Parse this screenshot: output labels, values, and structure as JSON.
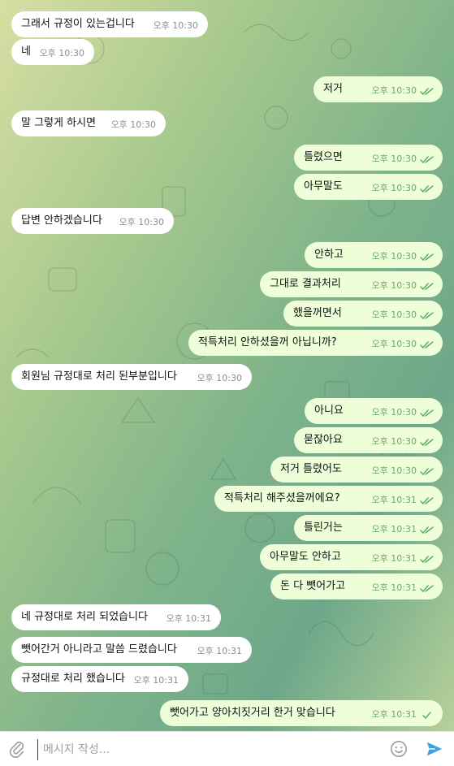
{
  "messages": [
    {
      "dir": "in",
      "text": "그래서 규정이 있는겁니다",
      "time": "오후 10:30"
    },
    {
      "dir": "in",
      "text": "네",
      "time": "오후 10:30"
    },
    {
      "dir": "out",
      "text": "저거",
      "time": "오후 10:30",
      "read": true
    },
    {
      "dir": "in",
      "text": "말 그렇게 하시면",
      "time": "오후 10:30"
    },
    {
      "dir": "out",
      "text": "틀렸으면",
      "time": "오후 10:30",
      "read": true
    },
    {
      "dir": "out",
      "text": "아무말도",
      "time": "오후 10:30",
      "read": true
    },
    {
      "dir": "in",
      "text": "답변 안하겠습니다",
      "time": "오후 10:30"
    },
    {
      "dir": "out",
      "text": "안하고",
      "time": "오후 10:30",
      "read": true
    },
    {
      "dir": "out",
      "text": "그대로 결과처리",
      "time": "오후 10:30",
      "read": true
    },
    {
      "dir": "out",
      "text": "했을꺼면서",
      "time": "오후 10:30",
      "read": true
    },
    {
      "dir": "out",
      "text": "적특처리 안하셨을꺼 아닙니까?",
      "time": "오후 10:30",
      "read": true
    },
    {
      "dir": "in",
      "text": "회원님 규정대로 처리 된부분입니다",
      "time": "오후 10:30"
    },
    {
      "dir": "out",
      "text": "아니요",
      "time": "오후 10:30",
      "read": true
    },
    {
      "dir": "out",
      "text": "묻잖아요",
      "time": "오후 10:30",
      "read": true
    },
    {
      "dir": "out",
      "text": "저거 틀렸어도",
      "time": "오후 10:30",
      "read": true
    },
    {
      "dir": "out",
      "text": "적특처리 해주셨을꺼에요?",
      "time": "오후 10:31",
      "read": true
    },
    {
      "dir": "out",
      "text": "틀린거는",
      "time": "오후 10:31",
      "read": true
    },
    {
      "dir": "out",
      "text": "아무말도 안하고",
      "time": "오후 10:31",
      "read": true
    },
    {
      "dir": "out",
      "text": "돈 다 뺏어가고",
      "time": "오후 10:31",
      "read": true
    },
    {
      "dir": "in",
      "text": "네 규정대로 처리 되었습니다",
      "time": "오후 10:31"
    },
    {
      "dir": "in",
      "text": "뺏어간거 아니라고 말씀 드렸습니다",
      "time": "오후 10:31"
    },
    {
      "dir": "in",
      "text": "규정대로 처리 했습니다",
      "time": "오후 10:31"
    },
    {
      "dir": "out",
      "text": "뺏어가고 양아치짓거리 한거 맞습니다",
      "time": "오후 10:31",
      "read": false
    }
  ],
  "composer": {
    "placeholder": "메시지 작성..."
  },
  "icons": {
    "attach": "paperclip-icon",
    "emoji": "smiley-icon",
    "send": "send-icon"
  },
  "colors": {
    "incoming_bubble": "#ffffff",
    "outgoing_bubble": "#eefed9",
    "check_color": "#5fae63",
    "send_color": "#3b9fe0"
  }
}
